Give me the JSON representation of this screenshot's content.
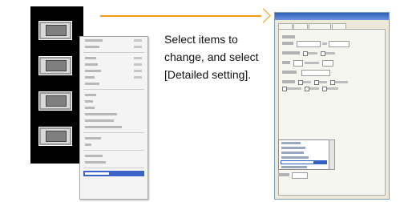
{
  "instruction": {
    "text": "Select items to change, and select [Detailed setting]."
  },
  "context_menu": {
    "selected_item": "Detailed setting"
  },
  "colors": {
    "arrow": "#f39c12",
    "selection": "#3b62c8",
    "canvas_bg": "#000000",
    "dialog_title": "#2f5fb8"
  },
  "icons": [
    "arrow-right-icon",
    "component-part-icon",
    "context-menu-icon",
    "dialog-window-icon"
  ]
}
